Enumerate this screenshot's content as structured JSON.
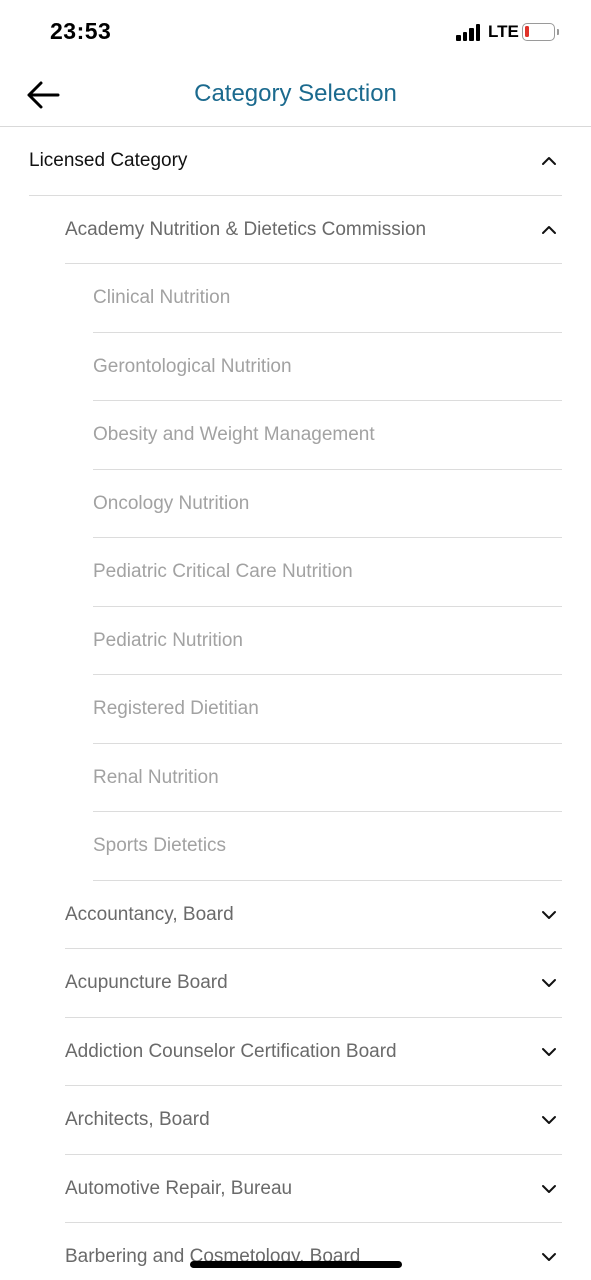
{
  "status_bar": {
    "time": "23:53",
    "network": "LTE"
  },
  "nav": {
    "title": "Category Selection"
  },
  "tree": {
    "root": {
      "label": "Licensed Category",
      "expanded": true
    },
    "groups": [
      {
        "label": "Academy Nutrition & Dietetics Commission",
        "expanded": true,
        "children": [
          "Clinical Nutrition",
          "Gerontological Nutrition",
          "Obesity and Weight Management",
          "Oncology Nutrition",
          "Pediatric Critical Care Nutrition",
          "Pediatric Nutrition",
          "Registered Dietitian",
          "Renal Nutrition",
          "Sports Dietetics"
        ]
      },
      {
        "label": "Accountancy, Board",
        "expanded": false
      },
      {
        "label": "Acupuncture Board",
        "expanded": false
      },
      {
        "label": "Addiction Counselor Certification Board",
        "expanded": false
      },
      {
        "label": "Architects, Board",
        "expanded": false
      },
      {
        "label": "Automotive Repair, Bureau",
        "expanded": false
      },
      {
        "label": "Barbering and Cosmetology, Board",
        "expanded": false
      }
    ]
  },
  "colors": {
    "accent": "#1b6a8e",
    "battery_low": "#e0322a"
  },
  "icons": {
    "back": "arrow-left-icon",
    "expanded": "chevron-up-icon",
    "collapsed": "chevron-down-icon"
  }
}
